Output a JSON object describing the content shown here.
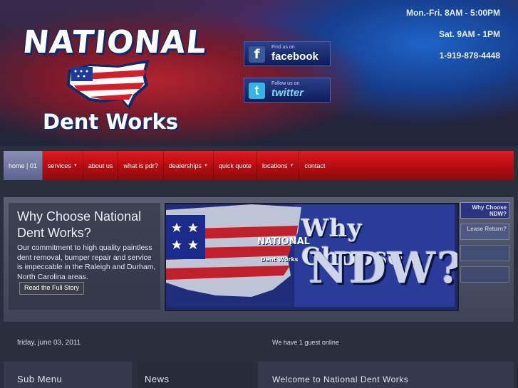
{
  "header": {
    "logo_top": "NATIONAL",
    "logo_bottom": "Dent Works",
    "facebook": {
      "small": "Find us on",
      "big": "facebook"
    },
    "twitter": {
      "small": "Follow us on",
      "big": "twitter"
    },
    "hours_weekday": "Mon.-Fri. 8AM - 5:00PM",
    "hours_saturday": "Sat. 9AM - 1PM",
    "phone": "1-919-878-4448"
  },
  "nav": {
    "items": [
      {
        "label": "home | 01",
        "active": true,
        "caret": false
      },
      {
        "label": "services",
        "active": false,
        "caret": true
      },
      {
        "label": "about us",
        "active": false,
        "caret": false
      },
      {
        "label": "what is pdr?",
        "active": false,
        "caret": false
      },
      {
        "label": "dealerships",
        "active": false,
        "caret": true
      },
      {
        "label": "quick quote",
        "active": false,
        "caret": false
      },
      {
        "label": "locations",
        "active": false,
        "caret": true
      },
      {
        "label": "contact",
        "active": false,
        "caret": false
      }
    ]
  },
  "feature": {
    "title": "Why Choose National Dent Works?",
    "body": "Our commitment to high quality paintless dent removal, bumper repair and service is impeccable in the Raleigh and Durham, North Carolina areas.",
    "read_more": "Read the Full Story",
    "image": {
      "line1": "Why Choose",
      "line2": "NDW?",
      "logo_top": "NATIONAL",
      "logo_bottom": "Dent Works"
    },
    "thumbs": [
      {
        "label": "Why Choose NDW?"
      },
      {
        "label": "Lease Return?"
      },
      {
        "label": ""
      },
      {
        "label": ""
      }
    ]
  },
  "info": {
    "date": "friday, june 03, 2011",
    "online": "We have 1 guest online"
  },
  "bottom": {
    "submenu_title": "Sub Menu",
    "news_title": "News",
    "welcome_title": "Welcome to National Dent Works"
  }
}
